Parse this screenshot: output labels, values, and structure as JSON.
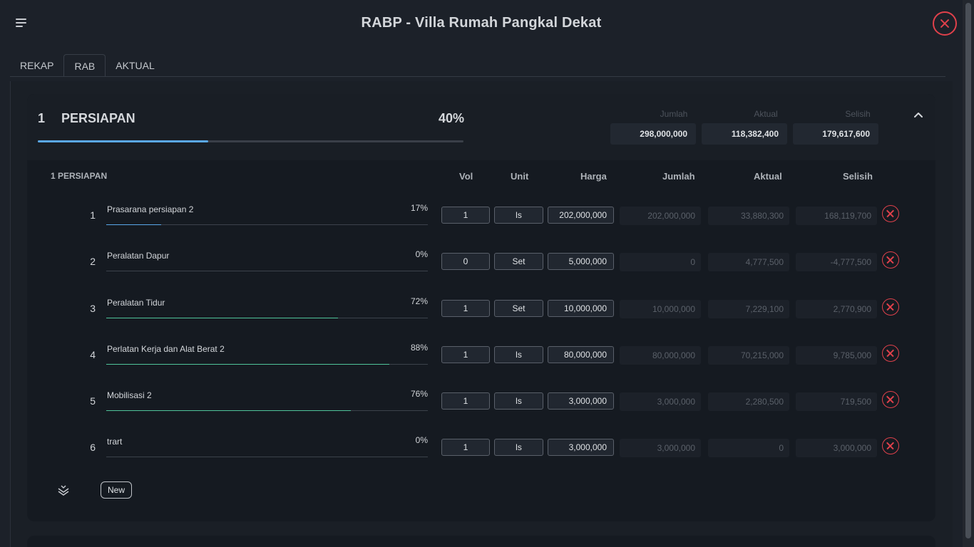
{
  "header": {
    "title": "RABP - Villa Rumah Pangkal Dekat",
    "menu_icon": "hamburger-menu-icon",
    "close_icon": "close-circle-icon",
    "accent_close": "#e0414b"
  },
  "tabs": [
    {
      "label": "REKAP",
      "active": false
    },
    {
      "label": "RAB",
      "active": true
    },
    {
      "label": "AKTUAL",
      "active": false
    }
  ],
  "section": {
    "number": "1",
    "name": "PERSIAPAN",
    "percent_label": "40%",
    "progress": 0.4,
    "progress_color": "#5aa8ea",
    "summary": {
      "jumlah_label": "Jumlah",
      "jumlah": "298,000,000",
      "aktual_label": "Aktual",
      "aktual": "118,382,400",
      "selisih_label": "Selisih",
      "selisih": "179,617,600"
    },
    "collapse_icon": "chevron-up-icon"
  },
  "table": {
    "group_title": "1 PERSIAPAN",
    "columns": {
      "vol": "Vol",
      "unit": "Unit",
      "harga": "Harga",
      "jumlah": "Jumlah",
      "aktual": "Aktual",
      "selisih": "Selisih"
    },
    "rows": [
      {
        "no": "1",
        "name": "Prasarana persiapan 2",
        "pct": "17%",
        "progress": 0.17,
        "bar_color": "#5aa8ea",
        "vol": "1",
        "unit": "ls",
        "harga": "202,000,000",
        "jumlah": "202,000,000",
        "aktual": "33,880,300",
        "selisih": "168,119,700"
      },
      {
        "no": "2",
        "name": "Peralatan Dapur",
        "pct": "0%",
        "progress": 0,
        "bar_color": "#5aa8ea",
        "vol": "0",
        "unit": "Set",
        "harga": "5,000,000",
        "jumlah": "0",
        "aktual": "4,777,500",
        "selisih": "-4,777,500"
      },
      {
        "no": "3",
        "name": "Peralatan Tidur",
        "pct": "72%",
        "progress": 0.72,
        "bar_color": "#4fc49a",
        "vol": "1",
        "unit": "Set",
        "harga": "10,000,000",
        "jumlah": "10,000,000",
        "aktual": "7,229,100",
        "selisih": "2,770,900"
      },
      {
        "no": "4",
        "name": "Perlatan Kerja dan Alat Berat 2",
        "pct": "88%",
        "progress": 0.88,
        "bar_color": "#4fc49a",
        "vol": "1",
        "unit": "ls",
        "harga": "80,000,000",
        "jumlah": "80,000,000",
        "aktual": "70,215,000",
        "selisih": "9,785,000"
      },
      {
        "no": "5",
        "name": "Mobilisasi 2",
        "pct": "76%",
        "progress": 0.76,
        "bar_color": "#4fc49a",
        "vol": "1",
        "unit": "ls",
        "harga": "3,000,000",
        "jumlah": "3,000,000",
        "aktual": "2,280,500",
        "selisih": "719,500"
      },
      {
        "no": "6",
        "name": "trart",
        "pct": "0%",
        "progress": 0,
        "bar_color": "#5aa8ea",
        "vol": "1",
        "unit": "ls",
        "harga": "3,000,000",
        "jumlah": "3,000,000",
        "aktual": "0",
        "selisih": "3,000,000"
      }
    ]
  },
  "footer": {
    "expand_icon": "expand-all-chevrons-icon",
    "new_label": "New"
  }
}
